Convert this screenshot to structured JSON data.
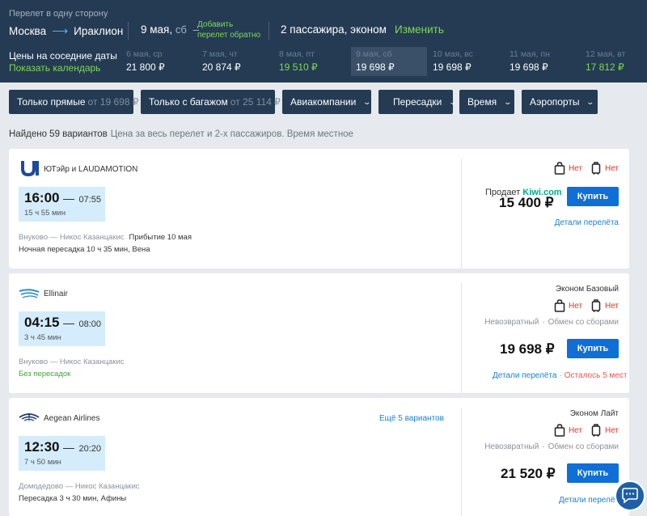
{
  "header": {
    "trip_type": "Перелет в одну сторону",
    "origin": "Москва",
    "destination": "Ираклион",
    "date": "9 мая,",
    "dow": "сб",
    "add_return": "Добавить перелет обратно",
    "passengers": "2 пассажира, эконом",
    "change_label": "Изменить"
  },
  "calendar": {
    "label": "Цены на соседние даты",
    "show_link": "Показать календарь",
    "days": [
      {
        "date": "6 мая, ср",
        "price": "21 800 ₽",
        "highlight": false,
        "selected": false
      },
      {
        "date": "7 мая, чт",
        "price": "20 874 ₽",
        "highlight": false,
        "selected": false
      },
      {
        "date": "8 мая, пт",
        "price": "19 510 ₽",
        "highlight": true,
        "selected": false
      },
      {
        "date": "9 мая, сб",
        "price": "19 698 ₽",
        "highlight": false,
        "selected": true
      },
      {
        "date": "10 мая, вс",
        "price": "19 698 ₽",
        "highlight": false,
        "selected": false
      },
      {
        "date": "11 мая, пн",
        "price": "19 698 ₽",
        "highlight": false,
        "selected": false
      },
      {
        "date": "12 мая, вт",
        "price": "17 812 ₽",
        "highlight": true,
        "selected": false
      }
    ]
  },
  "filters": {
    "direct": {
      "label": "Только прямые",
      "price": "от 19 698 ₽"
    },
    "baggage": {
      "label": "Только с багажом",
      "price": "от 25 114 ₽"
    },
    "airlines": "Авиакомпании",
    "transfers": "Пересадки",
    "time": "Время",
    "airports": "Аэропорты"
  },
  "summary": {
    "found": "Найдено 59 вариантов",
    "note": "Цена за весь перелет и 2-х пассажиров. Время местное"
  },
  "flights": [
    {
      "airline": "ЮТэйр и LAUDAMOTION",
      "dep": "16:00",
      "arr": "07:55",
      "duration": "15 ч 55 мин",
      "airports": "Внуково — Никос Казанцакис",
      "arrival_note": "Прибытие 10 мая",
      "transfer": "Ночная пересадка 10 ч 35 мин, Вена",
      "bag": "Нет",
      "luggage": "Нет",
      "seller_prefix": "Продает",
      "seller": "Kiwi.com",
      "price": "15 400 ₽",
      "buy": "Купить",
      "details": "Детали перелёта"
    },
    {
      "airline": "Ellinair",
      "dep": "04:15",
      "arr": "08:00",
      "duration": "3 ч 45 мин",
      "airports": "Внуково — Никос Казанцакис",
      "transfer": "Без пересадок",
      "fare": "Эконом Базовый",
      "bag": "Нет",
      "luggage": "Нет",
      "cond1": "Невозвратный",
      "cond2": "Обмен со сборами",
      "price": "19 698 ₽",
      "buy": "Купить",
      "details": "Детали перелёта",
      "seats_left": "Осталось 5 мест"
    },
    {
      "airline": "Aegean Airlines",
      "more": "Ещё 5 вариантов",
      "dep": "12:30",
      "arr": "20:20",
      "duration": "7 ч 50 мин",
      "airports": "Домодедово — Никос Казанцакис",
      "transfer": "Пересадка 3 ч 30 мин, Афины",
      "fare": "Эконом Лайт",
      "bag": "Нет",
      "luggage": "Нет",
      "cond1": "Невозвратный",
      "cond2": "Обмен со сборами",
      "price": "21 520 ₽",
      "buy": "Купить",
      "details": "Детали перелёта"
    }
  ],
  "colors": {
    "header_bg": "#243b53",
    "accent_green": "#7ed957",
    "button_blue": "#0f6fd6",
    "time_box": "#d4ecfb",
    "alert_red": "#e0362b"
  }
}
